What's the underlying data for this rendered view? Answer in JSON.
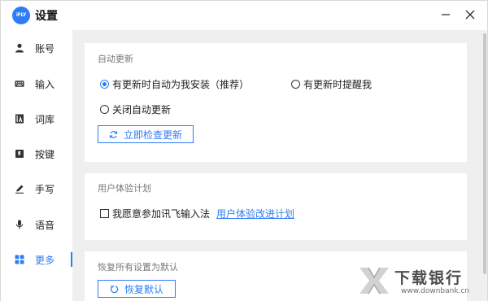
{
  "app": {
    "logo_text": "iFLY",
    "title": "设置"
  },
  "window_controls": {
    "minimize_icon": "minus-icon",
    "close_icon": "close-icon"
  },
  "sidebar": {
    "items": [
      {
        "label": "账号",
        "icon": "user-icon",
        "active": false
      },
      {
        "label": "输入",
        "icon": "keyboard-icon",
        "active": false
      },
      {
        "label": "词库",
        "icon": "dictionary-icon",
        "active": false
      },
      {
        "label": "按键",
        "icon": "key-icon",
        "active": false
      },
      {
        "label": "手写",
        "icon": "pen-icon",
        "active": false
      },
      {
        "label": "语音",
        "icon": "microphone-icon",
        "active": false
      },
      {
        "label": "更多",
        "icon": "grid-icon",
        "active": true
      }
    ]
  },
  "auto_update": {
    "title": "自动更新",
    "option_auto_install": "有更新时自动为我安装（推荐）",
    "option_notify": "有更新时提醒我",
    "option_off": "关闭自动更新",
    "selected": "option_auto_install",
    "check_button": "立即检查更新"
  },
  "experience_plan": {
    "title": "用户体验计划",
    "join_label": "我愿意参加讯飞输入法",
    "join_checked": false,
    "link_text": "用户体验改进计划"
  },
  "restore": {
    "title": "恢复所有设置为默认",
    "button": "恢复默认"
  },
  "watermark": {
    "main": "下载银行",
    "sub": "www.downbank.cn"
  },
  "colors": {
    "accent": "#2e7cf6",
    "panel_bg": "#efefef",
    "card_bg": "#ffffff"
  }
}
